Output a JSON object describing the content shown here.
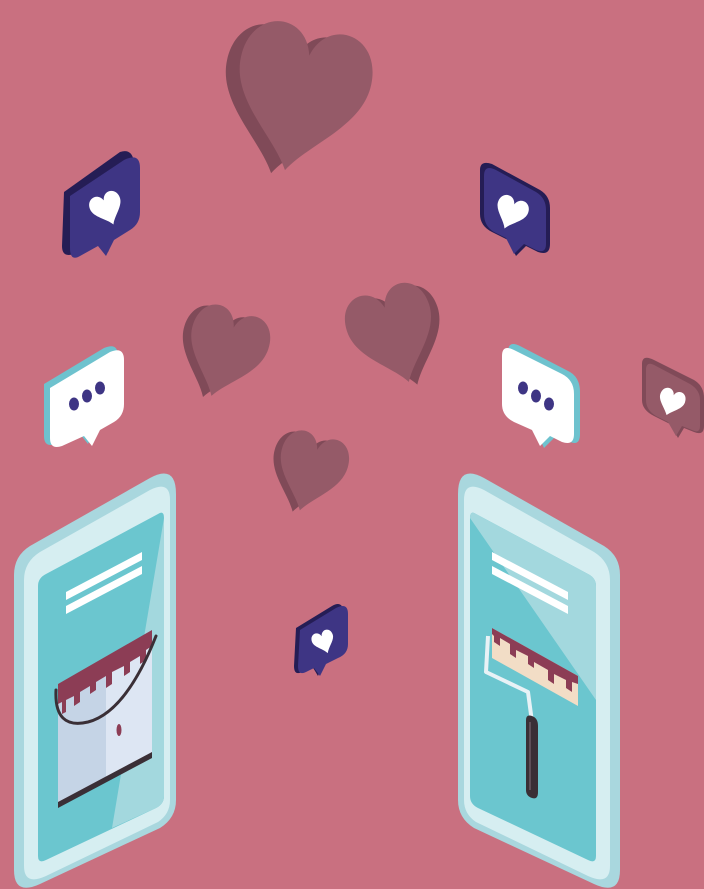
{
  "scene": {
    "title": "",
    "icons": [
      "heart-icon",
      "like-bubble-icon",
      "typing-bubble-icon",
      "smartphone-icon",
      "paint-bucket-icon",
      "paint-roller-icon"
    ]
  },
  "colors": {
    "background": "#C97080",
    "heart_front": "#955A68",
    "heart_side": "#804A58",
    "like_bubble_face": "#3E3584",
    "like_bubble_side": "#251D55",
    "typing_bubble_face": "#FFFFFF",
    "typing_bubble_side": "#6EC2CE",
    "typing_dots": "#3E3584",
    "phone_body": "#D6EEF1",
    "phone_edge": "#A9D7DE",
    "screen": "#6BC6CF",
    "screen_light": "#A3D8DE",
    "screen_lines": "#FFFFFF",
    "paint": "#8C3D55",
    "bucket": "#C5D4E6",
    "bucket_light": "#DDE6F3",
    "handle_dark": "#3A2F36",
    "roller": "#F2DDC6"
  }
}
